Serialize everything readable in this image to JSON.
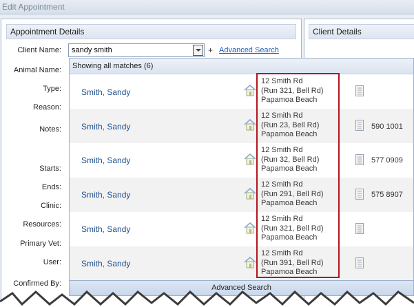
{
  "window": {
    "title": "Edit Appointment"
  },
  "left_panel": {
    "header": "Appointment Details",
    "labels": {
      "client_name": "Client Name:",
      "animal_name": "Animal Name:",
      "type": "Type:",
      "reason": "Reason:",
      "notes": "Notes:",
      "starts": "Starts:",
      "ends": "Ends:",
      "clinic": "Clinic:",
      "resources": "Resources:",
      "primary_vet": "Primary Vet:",
      "user": "User:",
      "confirmed_by": "Confirmed By:"
    },
    "client_input": {
      "value": "sandy smith"
    },
    "plus_label": "+",
    "advanced_search_link": "Advanced Search"
  },
  "right_panel": {
    "header": "Client Details"
  },
  "dropdown": {
    "header": "Showing all matches (6)",
    "footer": "Advanced Search",
    "rows": [
      {
        "name": "Smith, Sandy",
        "addr1": "12 Smith Rd",
        "addr2": "(Run 321, Bell Rd)",
        "addr3": "Papamoa Beach",
        "phone": ""
      },
      {
        "name": "Smith, Sandy",
        "addr1": "12 Smith Rd",
        "addr2": "(Run 23, Bell Rd)",
        "addr3": "Papamoa Beach",
        "phone": "590 1001"
      },
      {
        "name": "Smith, Sandy",
        "addr1": "12 Smith Rd",
        "addr2": "(Run 32, Bell Rd)",
        "addr3": "Papamoa Beach",
        "phone": "577 0909"
      },
      {
        "name": "Smith, Sandy",
        "addr1": "12 Smith Rd",
        "addr2": "(Run 291, Bell Rd)",
        "addr3": "Papamoa Beach",
        "phone": "575 8907"
      },
      {
        "name": "Smith, Sandy",
        "addr1": "12 Smith Rd",
        "addr2": "(Run 321, Bell Rd)",
        "addr3": "Papamoa Beach",
        "phone": ""
      },
      {
        "name": "Smith, Sandy",
        "addr1": "12 Smith Rd",
        "addr2": "(Run 391, Bell Rd)",
        "addr3": "Papamoa Beach",
        "phone": ""
      }
    ]
  },
  "colors": {
    "highlight": "#b3141c",
    "link": "#1f5fb0",
    "client_name": "#1f4f8f"
  },
  "icons": {
    "address": "house-icon",
    "phone": "phone-icon",
    "combo": "chevron-down-icon"
  }
}
